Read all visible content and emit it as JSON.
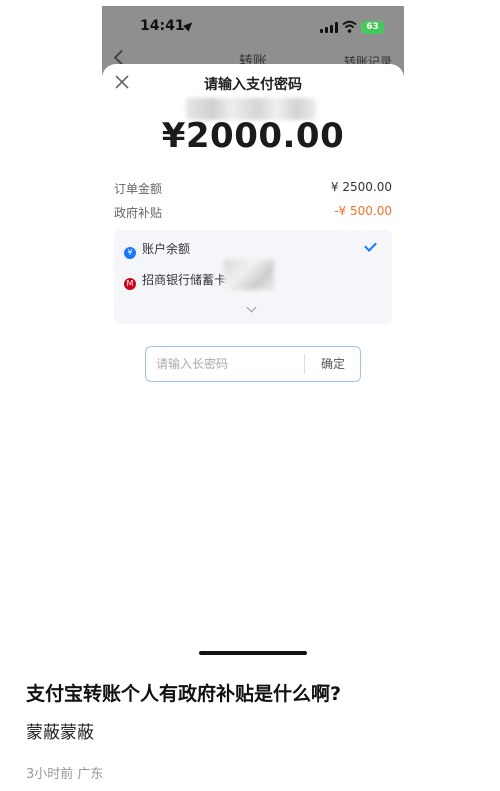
{
  "status_bar": {
    "time": "14:41",
    "battery": "63"
  },
  "nav": {
    "title": "转账",
    "right_link": "转账记录"
  },
  "sheet": {
    "title": "请输入支付密码",
    "amount": "¥2000.00",
    "rows": [
      {
        "label": "订单金额",
        "value": "¥ 2500.00"
      },
      {
        "label": "政府补贴",
        "value": "-¥ 500.00"
      }
    ],
    "payment_options": [
      {
        "label": "账户余额",
        "selected": true
      },
      {
        "label": "招商银行储蓄卡",
        "selected": false
      }
    ],
    "password": {
      "placeholder": "请输入长密码",
      "confirm_label": "确定"
    }
  },
  "colors": {
    "accent": "#1677ff",
    "subsidy": "#f0702a",
    "overlay": "#8f8f8f"
  },
  "icons": [
    "location-arrow-icon",
    "signal-icon",
    "wifi-icon",
    "battery-icon",
    "back-icon",
    "close-icon",
    "alipay-balance-icon",
    "cmb-bank-icon",
    "check-icon",
    "chevron-down-icon"
  ],
  "post": {
    "title": "支付宝转账个人有政府补贴是什么啊?",
    "author": "蒙蔽蒙蔽",
    "meta": "3小时前 广东"
  }
}
